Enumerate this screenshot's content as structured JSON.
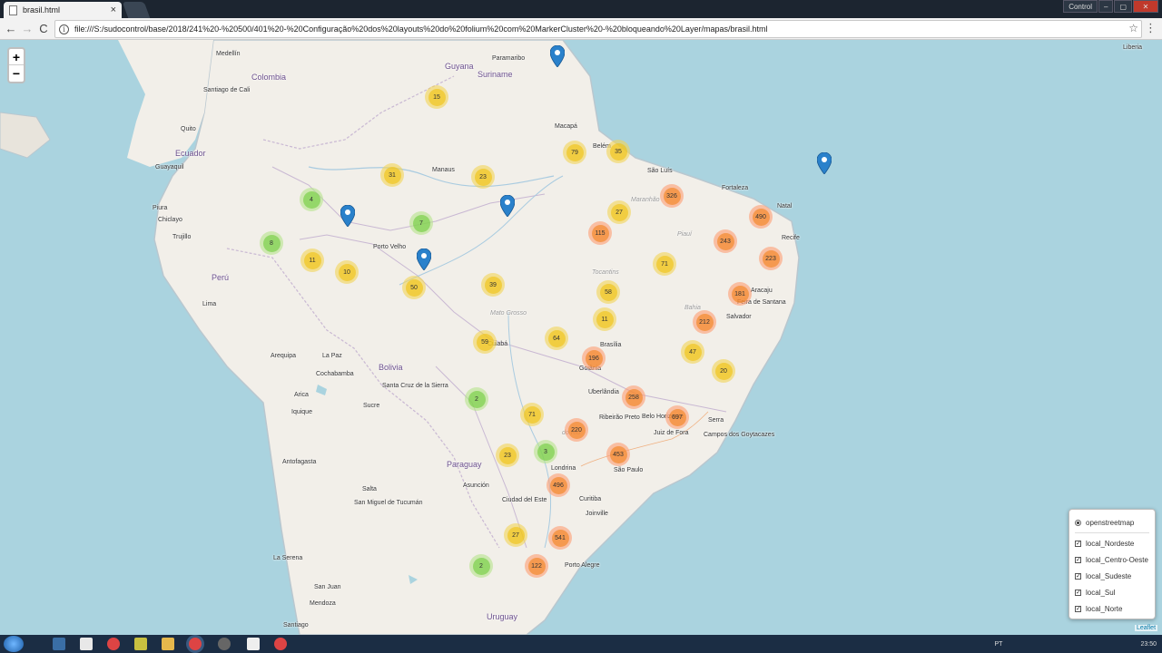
{
  "browser": {
    "tab_title": "brasil.html",
    "tab_close": "×",
    "url": "file:///S:/sudocontrol/base/2018/241%20-%20500/401%20-%20Configuração%20dos%20layouts%20do%20folium%20com%20MarkerCluster%20-%20bloqueando%20Layer/mapas/brasil.html",
    "window_button": "Control",
    "back": "←",
    "forward": "→",
    "reload": "C",
    "info": "i",
    "star": "☆",
    "menu": "⋮"
  },
  "map": {
    "zoom_in": "+",
    "zoom_out": "−",
    "attribution": "Leaflet",
    "labels": [
      {
        "text": "Medellín"
      },
      {
        "text": "Colombia"
      },
      {
        "text": "Guyana"
      },
      {
        "text": "Paramaribo"
      },
      {
        "text": "Suriname"
      },
      {
        "text": "Santiago de Cali"
      },
      {
        "text": "Quito"
      },
      {
        "text": "Ecuador"
      },
      {
        "text": "Guayaquil"
      },
      {
        "text": "Piura"
      },
      {
        "text": "Chiclayo"
      },
      {
        "text": "Trujillo"
      },
      {
        "text": "Perú"
      },
      {
        "text": "Lima"
      },
      {
        "text": "Manaus"
      },
      {
        "text": "Porto Velho"
      },
      {
        "text": "Macapá"
      },
      {
        "text": "Belém"
      },
      {
        "text": "São Luís"
      },
      {
        "text": "Fortaleza"
      },
      {
        "text": "Natal"
      },
      {
        "text": "Recife"
      },
      {
        "text": "Aracaju"
      },
      {
        "text": "Feira de Santana"
      },
      {
        "text": "Salvador"
      },
      {
        "text": "Brasília"
      },
      {
        "text": "Goiânia"
      },
      {
        "text": "Cuiabá"
      },
      {
        "text": "Bolivia"
      },
      {
        "text": "La Paz"
      },
      {
        "text": "Cochabamba"
      },
      {
        "text": "Santa Cruz de la Sierra"
      },
      {
        "text": "Sucre"
      },
      {
        "text": "Arequipa"
      },
      {
        "text": "Arica"
      },
      {
        "text": "Iquique"
      },
      {
        "text": "Antofagasta"
      },
      {
        "text": "Uberlândia"
      },
      {
        "text": "Ribeirão Preto"
      },
      {
        "text": "Belo Horizonte"
      },
      {
        "text": "Juiz de Fora"
      },
      {
        "text": "Serra"
      },
      {
        "text": "Campos dos Goytacazes"
      },
      {
        "text": "São Paulo"
      },
      {
        "text": "Londrina"
      },
      {
        "text": "Paraguay"
      },
      {
        "text": "Asunción"
      },
      {
        "text": "Ciudad del Este"
      },
      {
        "text": "Curitiba"
      },
      {
        "text": "Joinville"
      },
      {
        "text": "Salta"
      },
      {
        "text": "San Miguel de Tucumán"
      },
      {
        "text": "La Serena"
      },
      {
        "text": "San Juan"
      },
      {
        "text": "Mendoza"
      },
      {
        "text": "Santiago"
      },
      {
        "text": "Uruguay"
      },
      {
        "text": "Porto Alegre"
      },
      {
        "text": "Liberia"
      },
      {
        "text": "Mato Grosso"
      },
      {
        "text": "do Rio"
      },
      {
        "text": "Tocantins"
      },
      {
        "text": "Bahia"
      },
      {
        "text": "Maranhão"
      },
      {
        "text": "Piauí"
      }
    ],
    "clusters": [
      {
        "count": "15",
        "level": "yellow"
      },
      {
        "count": "79",
        "level": "yellow"
      },
      {
        "count": "35",
        "level": "yellow"
      },
      {
        "count": "31",
        "level": "yellow"
      },
      {
        "count": "23",
        "level": "yellow"
      },
      {
        "count": "326",
        "level": "orange"
      },
      {
        "count": "4",
        "level": "green"
      },
      {
        "count": "7",
        "level": "green"
      },
      {
        "count": "27",
        "level": "yellow"
      },
      {
        "count": "490",
        "level": "orange"
      },
      {
        "count": "115",
        "level": "orange"
      },
      {
        "count": "243",
        "level": "orange"
      },
      {
        "count": "8",
        "level": "green"
      },
      {
        "count": "11",
        "level": "yellow"
      },
      {
        "count": "10",
        "level": "yellow"
      },
      {
        "count": "223",
        "level": "orange"
      },
      {
        "count": "71",
        "level": "yellow"
      },
      {
        "count": "50",
        "level": "yellow"
      },
      {
        "count": "39",
        "level": "yellow"
      },
      {
        "count": "58",
        "level": "yellow"
      },
      {
        "count": "181",
        "level": "orange"
      },
      {
        "count": "11",
        "level": "yellow"
      },
      {
        "count": "212",
        "level": "orange"
      },
      {
        "count": "59",
        "level": "yellow"
      },
      {
        "count": "64",
        "level": "yellow"
      },
      {
        "count": "196",
        "level": "orange"
      },
      {
        "count": "47",
        "level": "yellow"
      },
      {
        "count": "20",
        "level": "yellow"
      },
      {
        "count": "2",
        "level": "green"
      },
      {
        "count": "258",
        "level": "orange"
      },
      {
        "count": "71",
        "level": "yellow"
      },
      {
        "count": "697",
        "level": "orange"
      },
      {
        "count": "220",
        "level": "orange"
      },
      {
        "count": "23",
        "level": "yellow"
      },
      {
        "count": "3",
        "level": "green"
      },
      {
        "count": "453",
        "level": "orange"
      },
      {
        "count": "496",
        "level": "orange"
      },
      {
        "count": "27",
        "level": "yellow"
      },
      {
        "count": "541",
        "level": "orange"
      },
      {
        "count": "2",
        "level": "green"
      },
      {
        "count": "122",
        "level": "orange"
      }
    ],
    "pins": [
      "marker",
      "marker",
      "marker",
      "marker",
      "marker"
    ]
  },
  "layer_control": {
    "base": "openstreetmap",
    "overlays": [
      "local_Nordeste",
      "local_Centro-Oeste",
      "local_Sudeste",
      "local_Sul",
      "local_Norte"
    ],
    "check_mark": "✓"
  },
  "taskbar": {
    "lang": "PT",
    "time": "23:50"
  },
  "colors": {
    "cluster_green": "#6ecc39",
    "cluster_yellow": "#f0c20c",
    "cluster_orange": "#f18017",
    "water": "#aad3df",
    "land": "#f2efe9",
    "marker": "#2a81cb"
  }
}
